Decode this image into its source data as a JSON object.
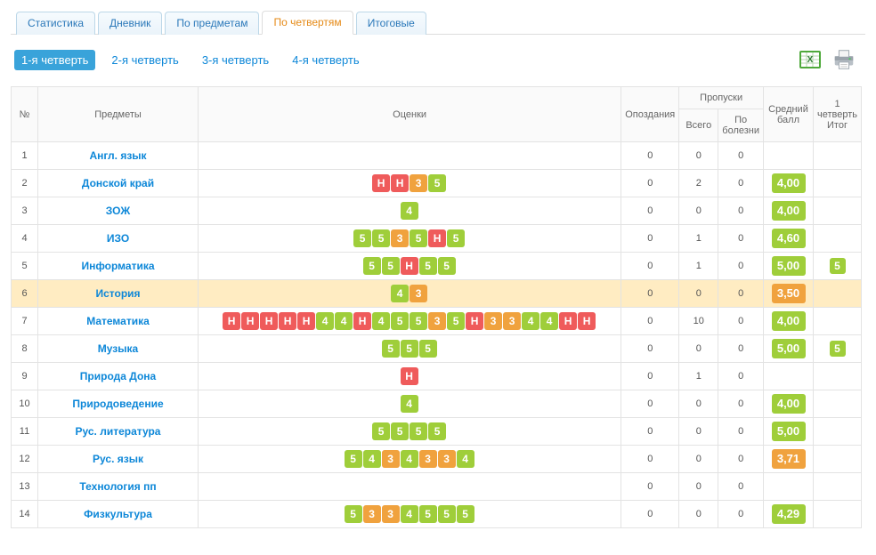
{
  "tabs": {
    "items": [
      {
        "label": "Статистика",
        "active": false
      },
      {
        "label": "Дневник",
        "active": false
      },
      {
        "label": "По предметам",
        "active": false
      },
      {
        "label": "По четвертям",
        "active": true
      },
      {
        "label": "Итоговые",
        "active": false
      }
    ]
  },
  "quarters": {
    "items": [
      {
        "label": "1-я четверть",
        "active": true
      },
      {
        "label": "2-я четверть",
        "active": false
      },
      {
        "label": "3-я четверть",
        "active": false
      },
      {
        "label": "4-я четверть",
        "active": false
      }
    ]
  },
  "table": {
    "headers": {
      "num": "№",
      "subject": "Предметы",
      "marks": "Оценки",
      "late": "Опоздания",
      "absences_group": "Пропуски",
      "abs_total": "Всего",
      "abs_ill": "По болезни",
      "avg": "Средний балл",
      "final": "1 четверть Итог"
    },
    "rows": [
      {
        "num": 1,
        "subject": "Англ. язык",
        "marks": [],
        "late": 0,
        "abs_total": 0,
        "abs_ill": 0,
        "avg": null,
        "final": null,
        "hl": false
      },
      {
        "num": 2,
        "subject": "Донской край",
        "marks": [
          "Н",
          "Н",
          "3",
          "5"
        ],
        "late": 0,
        "abs_total": 2,
        "abs_ill": 0,
        "avg": "4,00",
        "final": null,
        "hl": false
      },
      {
        "num": 3,
        "subject": "ЗОЖ",
        "marks": [
          "4"
        ],
        "late": 0,
        "abs_total": 0,
        "abs_ill": 0,
        "avg": "4,00",
        "final": null,
        "hl": false
      },
      {
        "num": 4,
        "subject": "ИЗО",
        "marks": [
          "5",
          "5",
          "3",
          "5",
          "Н",
          "5"
        ],
        "late": 0,
        "abs_total": 1,
        "abs_ill": 0,
        "avg": "4,60",
        "final": null,
        "hl": false
      },
      {
        "num": 5,
        "subject": "Информатика",
        "marks": [
          "5",
          "5",
          "Н",
          "5",
          "5"
        ],
        "late": 0,
        "abs_total": 1,
        "abs_ill": 0,
        "avg": "5,00",
        "final": "5",
        "hl": false
      },
      {
        "num": 6,
        "subject": "История",
        "marks": [
          "4",
          "3"
        ],
        "late": 0,
        "abs_total": 0,
        "abs_ill": 0,
        "avg": "3,50",
        "avg_color": "orange",
        "final": null,
        "hl": true
      },
      {
        "num": 7,
        "subject": "Математика",
        "marks": [
          "Н",
          "Н",
          "Н",
          "Н",
          "Н",
          "4",
          "4",
          "Н",
          "4",
          "5",
          "5",
          "3",
          "5",
          "Н",
          "3",
          "3",
          "4",
          "4",
          "Н",
          "Н"
        ],
        "late": 0,
        "abs_total": 10,
        "abs_ill": 0,
        "avg": "4,00",
        "final": null,
        "hl": false
      },
      {
        "num": 8,
        "subject": "Музыка",
        "marks": [
          "5",
          "5",
          "5"
        ],
        "late": 0,
        "abs_total": 0,
        "abs_ill": 0,
        "avg": "5,00",
        "final": "5",
        "hl": false
      },
      {
        "num": 9,
        "subject": "Природа Дона",
        "marks": [
          "Н"
        ],
        "late": 0,
        "abs_total": 1,
        "abs_ill": 0,
        "avg": null,
        "final": null,
        "hl": false
      },
      {
        "num": 10,
        "subject": "Природоведение",
        "marks": [
          "4"
        ],
        "late": 0,
        "abs_total": 0,
        "abs_ill": 0,
        "avg": "4,00",
        "final": null,
        "hl": false
      },
      {
        "num": 11,
        "subject": "Рус. литература",
        "marks": [
          "5",
          "5",
          "5",
          "5"
        ],
        "late": 0,
        "abs_total": 0,
        "abs_ill": 0,
        "avg": "5,00",
        "final": null,
        "hl": false
      },
      {
        "num": 12,
        "subject": "Рус. язык",
        "marks": [
          "5",
          "4",
          "3",
          "4",
          "3",
          "3",
          "4"
        ],
        "late": 0,
        "abs_total": 0,
        "abs_ill": 0,
        "avg": "3,71",
        "avg_color": "orange",
        "final": null,
        "hl": false
      },
      {
        "num": 13,
        "subject": "Технология пп",
        "marks": [],
        "late": 0,
        "abs_total": 0,
        "abs_ill": 0,
        "avg": null,
        "final": null,
        "hl": false
      },
      {
        "num": 14,
        "subject": "Физкультура",
        "marks": [
          "5",
          "3",
          "3",
          "4",
          "5",
          "5",
          "5"
        ],
        "late": 0,
        "abs_total": 0,
        "abs_ill": 0,
        "avg": "4,29",
        "final": null,
        "hl": false
      }
    ]
  },
  "icons": {
    "excel": "excel-icon",
    "print": "print-icon"
  }
}
